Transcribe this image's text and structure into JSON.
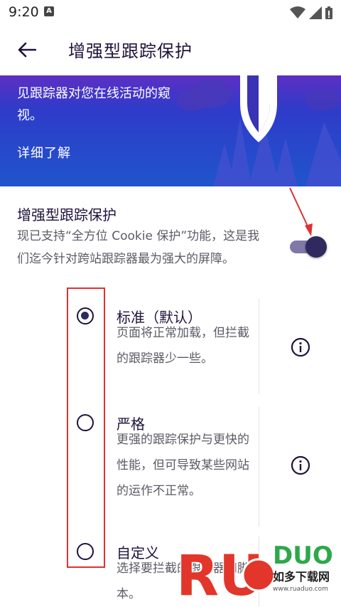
{
  "status_bar": {
    "time": "9:20",
    "app_icon": "A",
    "icons": [
      "wifi-icon",
      "signal-icon",
      "battery-icon"
    ]
  },
  "app_bar": {
    "back_icon": "arrow-back-icon",
    "title": "增强型跟踪保护"
  },
  "banner": {
    "text": "见跟踪器对您在线活动的窥视。",
    "learn_more": "详细了解",
    "art": [
      "shield-icon",
      "cloud-icon",
      "tree-icon"
    ]
  },
  "etp": {
    "title": "增强型跟踪保护",
    "description": "现已支持“全方位 Cookie 保护”功能，这是我们迄今针对跨站跟踪器最为强大的屏障。",
    "toggle_on": true
  },
  "options": [
    {
      "title": "标准（默认）",
      "description": "页面将正常加载，但拦截的跟踪器少一些。",
      "selected": true
    },
    {
      "title": "严格",
      "description": "更强的跟踪保护与更快的性能，但可导致某些网站的运作不正常。",
      "selected": false
    },
    {
      "title": "自定义",
      "description": "选择要拦截的跟踪器和脚本。",
      "selected": false
    }
  ],
  "watermark": {
    "logo_text": "RUADUO",
    "cn_text": "如多下载网",
    "url": "www.ruaduo.com"
  },
  "colors": {
    "banner_purple": "#5c2fc4",
    "banner_blue": "#1f55cc",
    "ink": "#20123a",
    "secondary": "#5b5b66",
    "annotation_red": "#e03131"
  }
}
